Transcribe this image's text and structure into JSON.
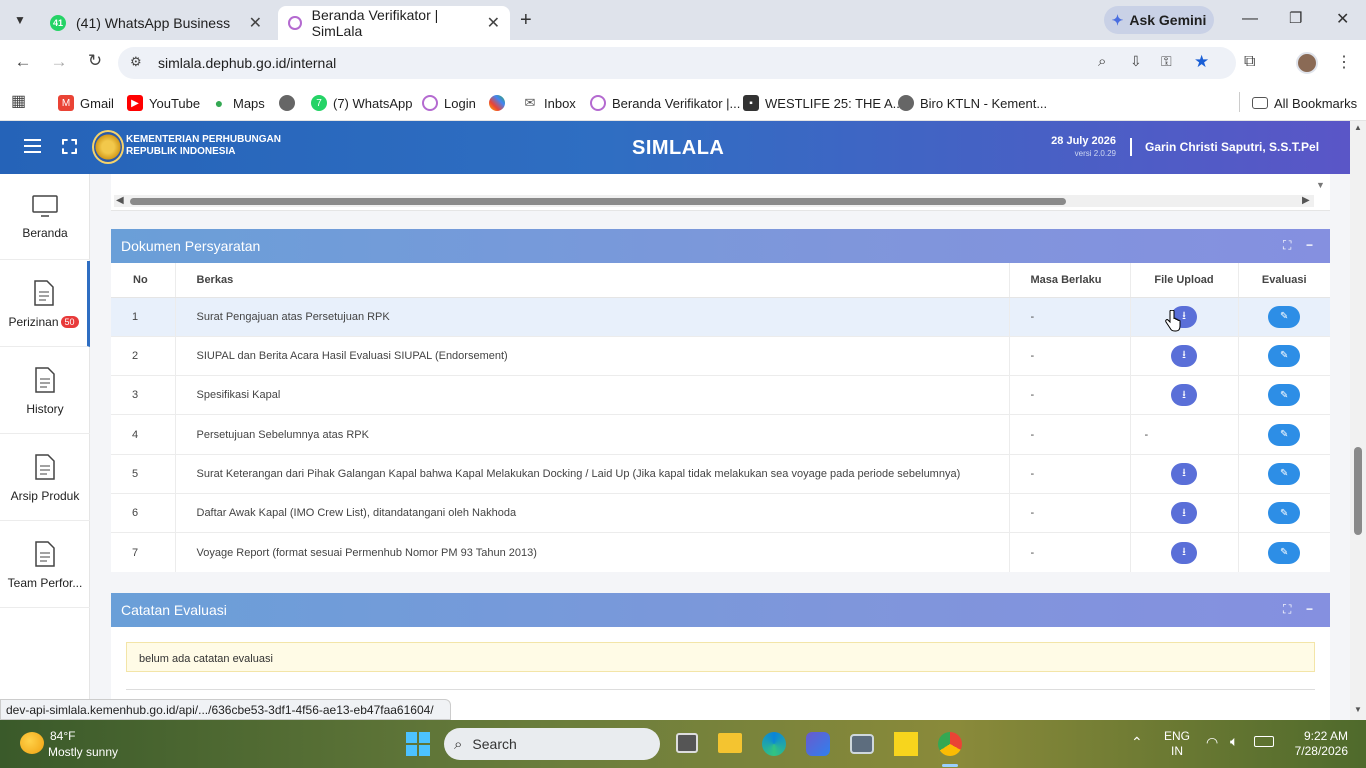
{
  "browser": {
    "tabs": [
      {
        "label": "(41) WhatsApp Business",
        "badge": "41"
      },
      {
        "label": "Beranda Verifikator | SimLala"
      }
    ],
    "ask_gemini": "Ask Gemini",
    "url": "simlala.dephub.go.id/internal",
    "bookmarks": [
      "Gmail",
      "YouTube",
      "Maps",
      "(7) WhatsApp",
      "Login",
      "Inbox",
      "Beranda Verifikator |...",
      "WESTLIFE 25: THE A...",
      "Biro KTLN - Kement..."
    ],
    "whatsapp_badge": "41",
    "all_bookmarks": "All Bookmarks",
    "status_url": "dev-api-simlala.kemenhub.go.id/api/.../636cbe53-3df1-4f56-ae13-eb47faa61604/"
  },
  "header": {
    "org_line1": "KEMENTERIAN PERHUBUNGAN",
    "org_line2": "REPUBLIK INDONESIA",
    "app_title": "SIMLALA",
    "date": "28 July 2026",
    "version": "versi 2.0.29",
    "user": "Garin Christi Saputri, S.S.T.Pel"
  },
  "sidebar": {
    "items": [
      {
        "label": "Beranda"
      },
      {
        "label": "Perizinan",
        "badge": "50"
      },
      {
        "label": "History"
      },
      {
        "label": "Arsip Produk"
      },
      {
        "label": "Team Perfor..."
      }
    ]
  },
  "documents": {
    "title": "Dokumen Persyaratan",
    "columns": [
      "No",
      "Berkas",
      "Masa Berlaku",
      "File Upload",
      "Evaluasi"
    ],
    "rows": [
      {
        "no": "1",
        "berkas": "Surat Pengajuan atas Persetujuan RPK",
        "masa": "-",
        "upload": true
      },
      {
        "no": "2",
        "berkas": "SIUPAL dan Berita Acara Hasil Evaluasi SIUPAL (Endorsement)",
        "masa": "-",
        "upload": true
      },
      {
        "no": "3",
        "berkas": "Spesifikasi Kapal",
        "masa": "-",
        "upload": true
      },
      {
        "no": "4",
        "berkas": "Persetujuan Sebelumnya atas RPK",
        "masa": "-",
        "upload": false,
        "upload_text": "-"
      },
      {
        "no": "5",
        "berkas": "Surat Keterangan dari Pihak Galangan Kapal bahwa Kapal Melakukan Docking / Laid Up (Jika kapal tidak melakukan sea voyage pada periode sebelumnya)",
        "masa": "-",
        "upload": true
      },
      {
        "no": "6",
        "berkas": "Daftar Awak Kapal (IMO Crew List), ditandatangani oleh Nakhoda",
        "masa": "-",
        "upload": true
      },
      {
        "no": "7",
        "berkas": "Voyage Report (format sesuai Permenhub Nomor PM 93 Tahun 2013)",
        "masa": "-",
        "upload": true
      }
    ]
  },
  "evaluation": {
    "title": "Catatan Evaluasi",
    "note": "belum ada catatan evaluasi"
  },
  "taskbar": {
    "weather_temp": "84°F",
    "weather_desc": "Mostly sunny",
    "search": "Search",
    "lang1": "ENG",
    "lang2": "IN",
    "time": "9:22 AM",
    "date": "7/28/2026"
  }
}
